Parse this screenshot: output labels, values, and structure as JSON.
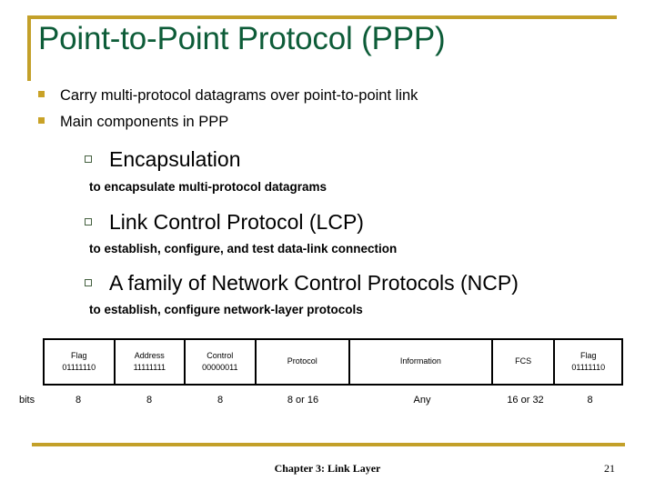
{
  "slide": {
    "title": "Point-to-Point Protocol (PPP)",
    "accent_gold": "#c3a029",
    "title_green": "#0d5c38",
    "bullet_gold": "#c9a227",
    "bullet_outline_green": "#44603f"
  },
  "bullets": {
    "level1": [
      {
        "text": "Carry multi-protocol datagrams over point-to-point link"
      },
      {
        "text": "Main components in PPP"
      }
    ],
    "components": [
      {
        "heading": "Encapsulation",
        "detail": "to encapsulate multi-protocol datagrams"
      },
      {
        "heading": "Link Control Protocol (LCP)",
        "detail": "to establish, configure, and test data-link connection"
      },
      {
        "heading": "A family of Network Control Protocols (NCP)",
        "detail": "to establish, configure network-layer protocols"
      }
    ]
  },
  "frame_table": {
    "bits_label": "bits",
    "fields": [
      {
        "name": "Flag",
        "value": "01111110",
        "bits": "8"
      },
      {
        "name": "Address",
        "value": "11111111",
        "bits": "8"
      },
      {
        "name": "Control",
        "value": "00000011",
        "bits": "8"
      },
      {
        "name": "Protocol",
        "value": "",
        "bits": "8 or 16"
      },
      {
        "name": "Information",
        "value": "",
        "bits": "Any"
      },
      {
        "name": "FCS",
        "value": "",
        "bits": "16 or 32"
      },
      {
        "name": "Flag",
        "value": "01111110",
        "bits": "8"
      }
    ]
  },
  "footer": {
    "text": "Chapter 3: Link Layer",
    "page_number": "21"
  }
}
